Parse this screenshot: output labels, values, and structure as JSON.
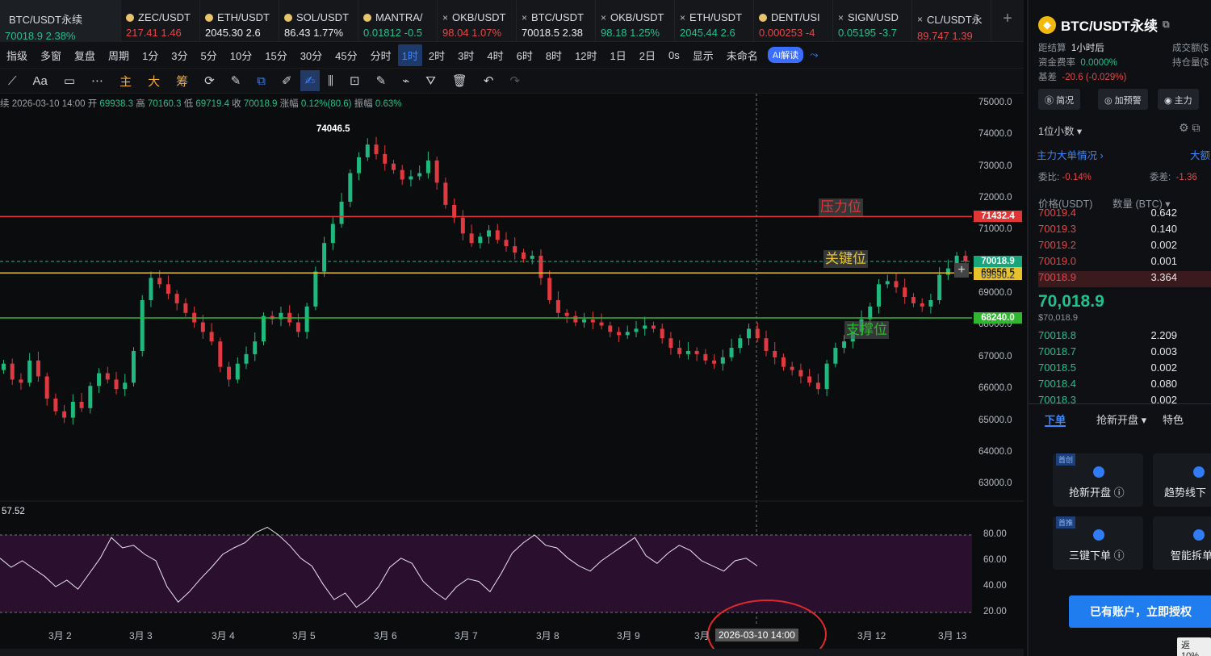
{
  "tabs": [
    {
      "name": "BTC/USDT永续",
      "value": "70018.9",
      "change": "2.38%",
      "dir": "up",
      "active": true
    },
    {
      "name": "ZEC/USDT",
      "value": "217.41",
      "change": "1.46",
      "dir": "down"
    },
    {
      "name": "ETH/USDT",
      "value": "2045.30",
      "change": "2.6",
      "dir": "white"
    },
    {
      "name": "SOL/USDT",
      "value": "86.43",
      "change": "1.77%",
      "dir": "white"
    },
    {
      "name": "MANTRA/",
      "value": "0.01812",
      "change": "-0.5",
      "dir": "up"
    },
    {
      "name": "OKB/USDT",
      "value": "98.04",
      "change": "1.07%",
      "dir": "down"
    },
    {
      "name": "BTC/USDT",
      "value": "70018.5",
      "change": "2.38",
      "dir": "white"
    },
    {
      "name": "OKB/USDT",
      "value": "98.18",
      "change": "1.25%",
      "dir": "up"
    },
    {
      "name": "ETH/USDT",
      "value": "2045.44",
      "change": "2.6",
      "dir": "up"
    },
    {
      "name": "DENT/USI",
      "value": "0.000253",
      "change": "-4",
      "dir": "down"
    },
    {
      "name": "SIGN/USD",
      "value": "0.05195",
      "change": "-3.7",
      "dir": "up"
    },
    {
      "name": "CL/USDT永",
      "value": "89.747",
      "change": "1.39",
      "dir": "down"
    }
  ],
  "toolbar1": {
    "items": [
      "指级",
      "多窗",
      "复盘",
      "周期",
      "1分",
      "3分",
      "5分",
      "10分",
      "15分",
      "30分",
      "45分",
      "分时",
      "1时",
      "2时",
      "3时",
      "4时",
      "6时",
      "8时",
      "12时",
      "1日",
      "2日",
      "0s",
      "显示",
      "未命名"
    ],
    "selected": "1时",
    "ai_label": "AI解读"
  },
  "toolbar2": {
    "text_tool": "Aa",
    "gold_labels": [
      "主",
      "大",
      "筹"
    ]
  },
  "ohlc": {
    "prefix": "续",
    "time": "2026-03-10 14:00",
    "open_lbl": "开",
    "open": "69938.3",
    "high_lbl": "高",
    "high": "70160.3",
    "low_lbl": "低",
    "low": "69719.4",
    "close_lbl": "收",
    "close": "70018.9",
    "chg_lbl": "涨幅",
    "chg": "0.12%(80.6)",
    "amp_lbl": "振幅",
    "amp": "0.63%"
  },
  "chart_data": {
    "type": "candlestick",
    "price_axis": [
      "75000.0",
      "74000.0",
      "73000.0",
      "72000.0",
      "71000.0",
      "70000.0",
      "69000.0",
      "68000.0",
      "67000.0",
      "66000.0",
      "65000.0",
      "64000.0",
      "63000.0"
    ],
    "ylim": [
      62600,
      75000
    ],
    "high_marker": "74046.5",
    "levels": [
      {
        "label": "压力位",
        "price": "71432.4",
        "value": 71432.4,
        "color": "#e03636"
      },
      {
        "label": "关键位",
        "price": "69656.5",
        "value": 69656.5,
        "color": "#e8c22b"
      },
      {
        "label": "支撑位",
        "price": "68240.0",
        "value": 68240.0,
        "color": "#2fb82f"
      }
    ],
    "last_price": "70018.9",
    "hidden_tag": "69590.2",
    "dates": [
      "3月 2",
      "3月 3",
      "3月 4",
      "3月 5",
      "3月 6",
      "3月 7",
      "3月 8",
      "3月 9",
      "3月",
      "3月 12",
      "3月 13"
    ],
    "crosshair_date": "2026-03-10 14:00",
    "close_series": [
      66800,
      66300,
      66200,
      66900,
      66400,
      65700,
      65300,
      65100,
      65600,
      65400,
      66100,
      66500,
      66300,
      66000,
      66200,
      67200,
      68800,
      69500,
      69300,
      69000,
      68700,
      68400,
      68100,
      67800,
      67500,
      66700,
      66300,
      66800,
      67100,
      67500,
      68300,
      68200,
      68400,
      68100,
      67800,
      68600,
      69700,
      70600,
      71200,
      71900,
      72800,
      73300,
      73700,
      73400,
      73100,
      72900,
      72600,
      72700,
      72800,
      73200,
      72500,
      71800,
      71400,
      70900,
      70600,
      70800,
      71000,
      70700,
      70500,
      70300,
      70100,
      70200,
      69500,
      68800,
      68400,
      68300,
      68100,
      68200,
      68100,
      68000,
      67800,
      67700,
      67800,
      67900,
      68000,
      67900,
      67600,
      67300,
      67100,
      67200,
      67100,
      66900,
      66800,
      67000,
      67300,
      67600,
      67900,
      67600,
      67200,
      67000,
      66700,
      66600,
      66400,
      66200,
      66000,
      66800,
      67300,
      67500,
      67800,
      68200,
      68600,
      69300,
      69400,
      69200,
      68900,
      68700,
      68600,
      68800,
      69600,
      69800,
      70200,
      70018.9
    ],
    "rsi_axis": [
      "80.00",
      "60.00",
      "40.00",
      "20.00"
    ],
    "rsi_value_label": "57.52",
    "rsi_series": [
      62,
      55,
      60,
      54,
      48,
      40,
      45,
      38,
      50,
      62,
      78,
      70,
      72,
      65,
      60,
      40,
      28,
      36,
      46,
      55,
      65,
      70,
      74,
      82,
      86,
      80,
      72,
      62,
      56,
      42,
      30,
      35,
      24,
      30,
      40,
      55,
      62,
      58,
      44,
      36,
      30,
      40,
      46,
      44,
      36,
      50,
      66,
      74,
      80,
      72,
      70,
      62,
      56,
      52,
      60,
      66,
      72,
      78,
      64,
      58,
      66,
      72,
      68,
      60,
      56,
      52,
      60,
      62,
      56
    ]
  },
  "right_panel": {
    "title": "BTC/USDT永续",
    "settle_lbl": "距结算",
    "settle_val": "1小时后",
    "volume_lbl": "成交额($",
    "funding_lbl": "资金费率",
    "funding_val": "0.0000%",
    "oi_lbl": "持仓量($",
    "basis_lbl": "基差",
    "basis_val": "-20.6 (-0.029%)",
    "buttons": [
      "简况",
      "加预警",
      "主力"
    ],
    "precision": "1位小数",
    "whale_lbl": "主力大单情况",
    "big_lbl": "大额",
    "ratio_lbl": "委比:",
    "ratio_val": "-0.14%",
    "diff_lbl": "委差:",
    "diff_val": "-1.36",
    "col_price": "价格(USDT)",
    "col_qty": "数量 (BTC)",
    "asks": [
      {
        "p": "70019.4",
        "q": "0.642"
      },
      {
        "p": "70019.3",
        "q": "0.140"
      },
      {
        "p": "70019.2",
        "q": "0.002"
      },
      {
        "p": "70019.0",
        "q": "0.001"
      },
      {
        "p": "70018.9",
        "q": "3.364"
      }
    ],
    "last": "70,018.9",
    "last_usd": "$70,018.9",
    "bids": [
      {
        "p": "70018.8",
        "q": "2.209"
      },
      {
        "p": "70018.7",
        "q": "0.003"
      },
      {
        "p": "70018.5",
        "q": "0.002"
      },
      {
        "p": "70018.4",
        "q": "0.080"
      },
      {
        "p": "70018.3",
        "q": "0.002"
      }
    ],
    "order_tabs": [
      "下单",
      "抢新开盘",
      "特色"
    ],
    "cards": [
      {
        "badge": "首创",
        "label": "抢新开盘 ⓘ"
      },
      {
        "badge": "",
        "label": "趋势线下"
      },
      {
        "badge": "首推",
        "label": "三键下单 ⓘ"
      },
      {
        "badge": "",
        "label": "智能拆单"
      }
    ],
    "cta": "已有账户，立即授权",
    "rebate": "返10%"
  }
}
